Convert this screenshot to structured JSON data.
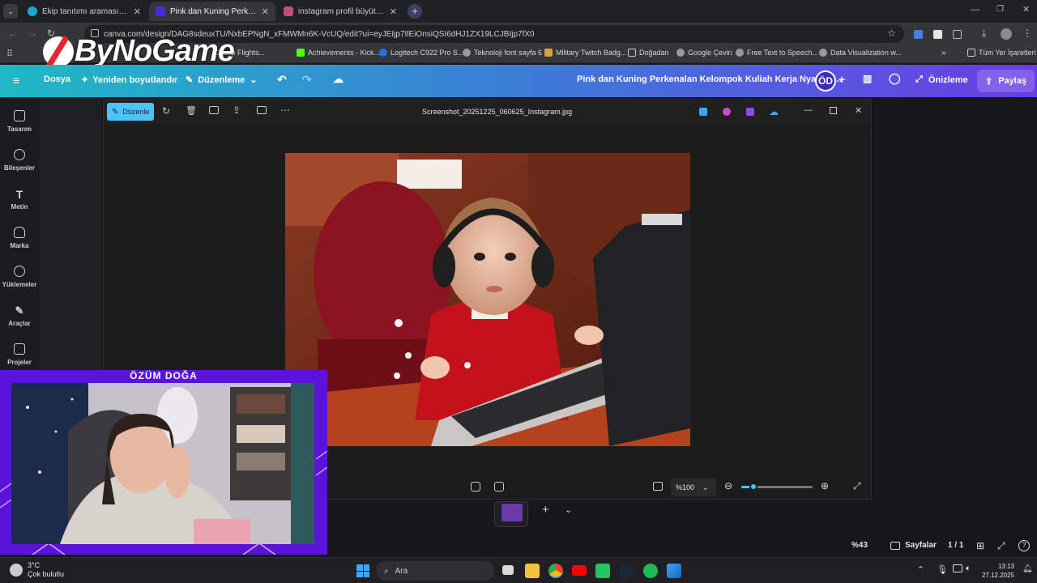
{
  "browser": {
    "tabs": [
      {
        "title": "Ekip tanıtımı araması - Canva",
        "active": false,
        "color": "#1da6d4"
      },
      {
        "title": "Pink dan Kuning Perkenalan Ke",
        "active": true,
        "color": "#4b2bd9"
      },
      {
        "title": "instagram profil büyütme instag",
        "active": false,
        "color": "#c6497c"
      }
    ],
    "url": "canva.com/design/DAG8sdeuxTU/NxbEPNgN_xFMWMn6K-VcUQ/edit?ui=eyJEIjp7IlEiOnsiQSI6dHJ1ZX19LCJBIjp7fX0",
    "bookmarks": [
      "Cheap Flights...",
      "Achievements - Kick...",
      "Logitech C922 Pro S...",
      "Teknoloji font sayfa 6",
      "Military Twitch Badg...",
      "Doğadan",
      "Google Çevin",
      "Free Text to Speech...",
      "Data Visualization w..."
    ],
    "all_bookmarks": "Tüm Yer İşaretleri"
  },
  "overlay": {
    "logo_text": "ByNoGame"
  },
  "canva": {
    "menu_file": "Dosya",
    "resize": "Yeniden boyutlandır",
    "edit_mode": "Düzenleme",
    "design_title": "Pink dan Kuning Perkenalan Kelompok Kuliah Kerja Nyata In...",
    "avatar_initials": "ÖD",
    "preview": "Önizleme",
    "share": "Paylaş",
    "sidebar": [
      {
        "label": "Tasarım",
        "icon": "design-icon"
      },
      {
        "label": "Bileşenler",
        "icon": "elements-icon"
      },
      {
        "label": "Metin",
        "icon": "text-icon"
      },
      {
        "label": "Marka",
        "icon": "brand-icon"
      },
      {
        "label": "Yüklemeler",
        "icon": "upload-icon"
      },
      {
        "label": "Araçlar",
        "icon": "tools-icon"
      },
      {
        "label": "Projeler",
        "icon": "projects-icon"
      }
    ],
    "zoom": "%43",
    "pages_label": "Sayfalar",
    "page_count": "1 / 1"
  },
  "viewer": {
    "edit_label": "Düzenle",
    "filename": "Screenshot_20251225_060625_Instagram.jpg",
    "zoom_value": "%100",
    "zoom_slider_fraction": 0.17
  },
  "stream": {
    "streamer_name": "ÖZÜM DOĞA"
  },
  "taskbar": {
    "weather_temp": "3°C",
    "weather_desc": "Çok bulutlu",
    "search_placeholder": "Ara",
    "time": "13:13",
    "date": "27.12.2025"
  }
}
